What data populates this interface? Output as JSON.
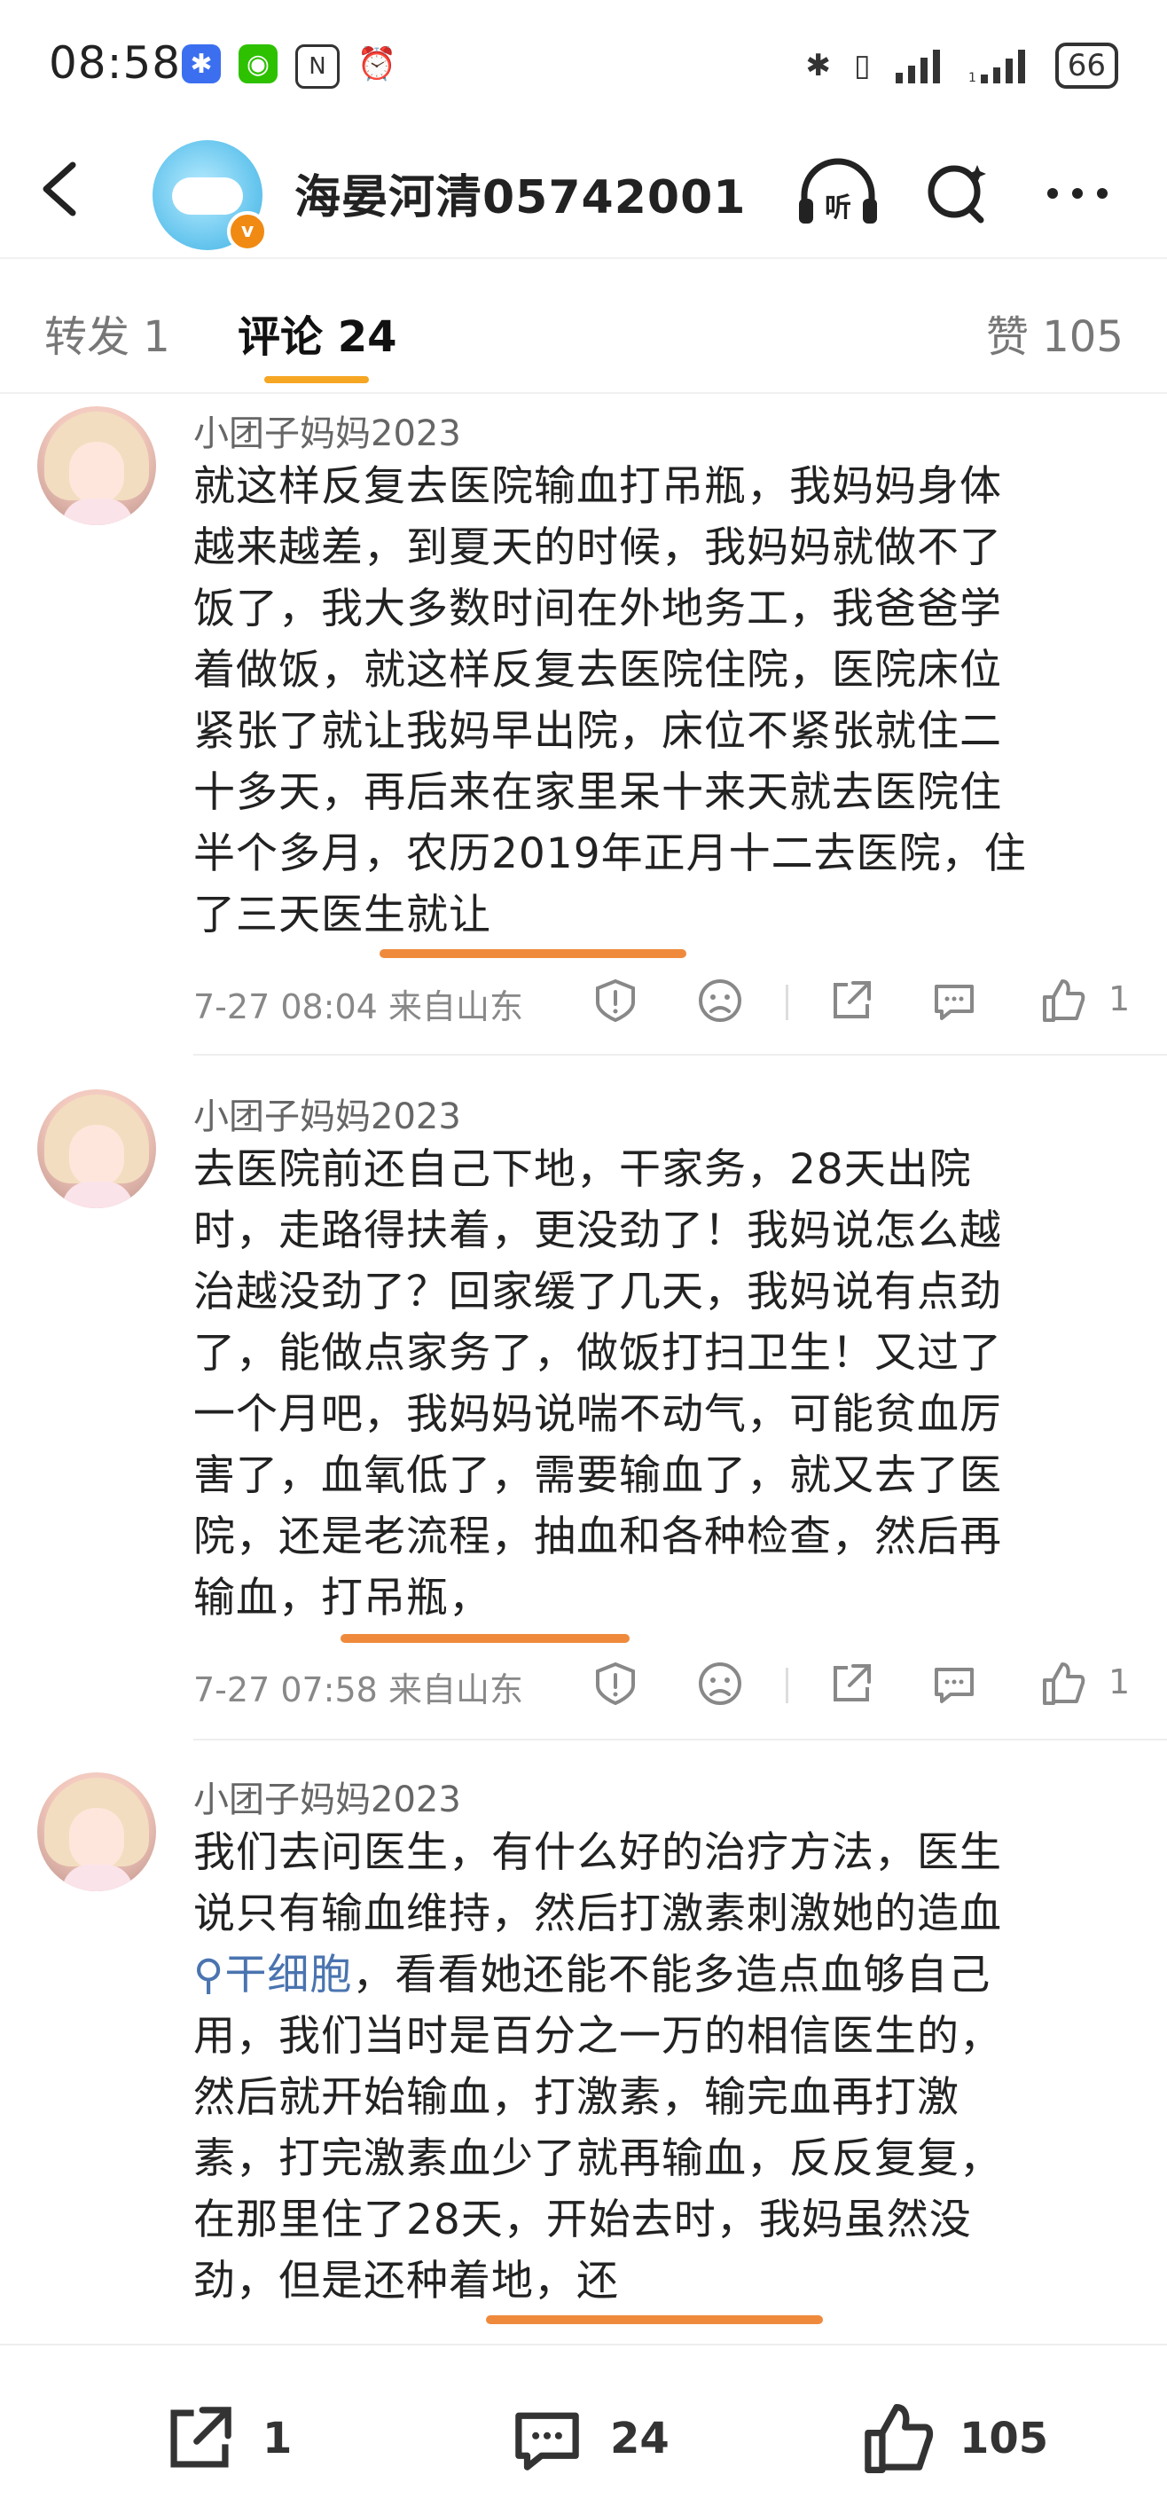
{
  "status_bar": {
    "time": "08:58",
    "left_icons": [
      "app-notify-icon",
      "wechat-icon",
      "nfc-icon",
      "alarm-icon"
    ],
    "right_icons": [
      "bluetooth-icon",
      "vibrate-icon",
      "signal-icon",
      "signal-icon-2"
    ],
    "battery": "66"
  },
  "header": {
    "title": "海晏河清05742001",
    "verified_badge": "v"
  },
  "tabs": {
    "forward": "转发 1",
    "comments": "评论 24",
    "likes": "赞 105"
  },
  "comments": [
    {
      "author": "小团子妈妈2023",
      "text": [
        "就这样反复去医院输血打吊瓶，我妈妈身体",
        "越来越差，到夏天的时候，我妈妈就做不了",
        "饭了，我大多数时间在外地务工，我爸爸学",
        "着做饭，就这样反复去医院住院，医院床位",
        "紧张了就让我妈早出院，床位不紧张就住二",
        "十多天，再后来在家里呆十来天就去医院住",
        "半个多月，农历2019年正月十二去医院，住",
        "了三天医生就让"
      ],
      "date": "7-27 08:04",
      "location": "来自山东",
      "likes": "1"
    },
    {
      "author": "小团子妈妈2023",
      "text": [
        "去医院前还自己下地，干家务，28天出院",
        "时，走路得扶着，更没劲了！我妈说怎么越",
        "治越没劲了？回家缓了几天，我妈说有点劲",
        "了，能做点家务了，做饭打扫卫生！又过了",
        "一个月吧，我妈妈说喘不动气，可能贫血厉",
        "害了，血氧低了，需要输血了，就又去了医",
        "院，还是老流程，抽血和各种检查，然后再",
        "输血，打吊瓶，"
      ],
      "date": "7-27 07:58",
      "location": "来自山东",
      "likes": "1"
    },
    {
      "author": "小团子妈妈2023",
      "text": [
        "我们去问医生，有什么好的治疗方法，医生",
        "说只有输血维持，然后打激素刺激她的造血"
      ],
      "link": "干细胞",
      "text_after_link": "，看看她还能不能多造点血够自己",
      "text_rest": [
        "用，我们当时是百分之一万的相信医生的，",
        "然后就开始输血，打激素，输完血再打激",
        "素，打完激素血少了就再输血，反反复复，",
        "在那里住了28天，开始去时，我妈虽然没",
        "劲，但是还种着地，还"
      ]
    }
  ],
  "bottom_bar": {
    "forward_count": "1",
    "comment_count": "24",
    "like_count": "105"
  },
  "colors": {
    "accent": "#f5a623",
    "underline": "#ef8a3c",
    "link": "#4a74b0",
    "verified": "#f08a12"
  }
}
